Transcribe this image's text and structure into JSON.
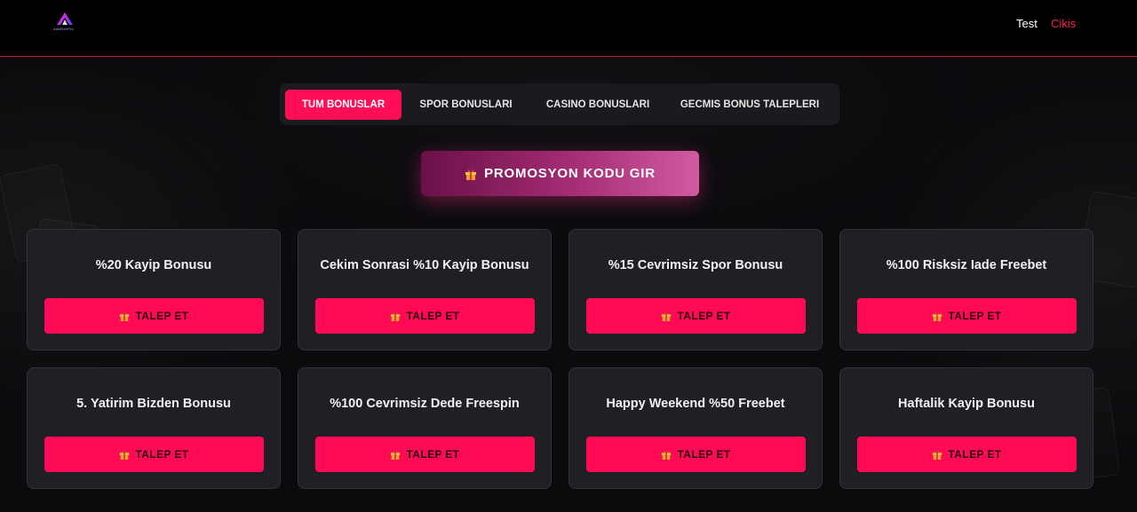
{
  "header": {
    "logo_text": "AdaFlexPro",
    "user_name": "Test",
    "logout_label": "Cikis"
  },
  "tabs": [
    {
      "label": "TUM BONUSLAR",
      "active": true
    },
    {
      "label": "SPOR BONUSLARI",
      "active": false
    },
    {
      "label": "CASINO BONUSLARI",
      "active": false
    },
    {
      "label": "GECMIS BONUS TALEPLERI",
      "active": false
    }
  ],
  "promo": {
    "label": "PROMOSYON KODU GIR",
    "icon": "gift-icon"
  },
  "bonuses": [
    {
      "title": "%20 Kayip Bonusu",
      "button_label": "TALEP ET"
    },
    {
      "title": "Cekim Sonrasi %10 Kayip Bonusu",
      "button_label": "TALEP ET"
    },
    {
      "title": "%15 Cevrimsiz Spor Bonusu",
      "button_label": "TALEP ET"
    },
    {
      "title": "%100 Risksiz Iade Freebet",
      "button_label": "TALEP ET"
    },
    {
      "title": "5. Yatirim Bizden Bonusu",
      "button_label": "TALEP ET"
    },
    {
      "title": "%100 Cevrimsiz Dede Freespin",
      "button_label": "TALEP ET"
    },
    {
      "title": "Happy Weekend %50 Freebet",
      "button_label": "TALEP ET"
    },
    {
      "title": "Haftalik Kayip Bonusu",
      "button_label": "TALEP ET"
    }
  ],
  "colors": {
    "accent": "#ff0d55",
    "header_line": "#c81c44",
    "card_bg": "#1f1f25",
    "page_bg": "#0b0a0d"
  }
}
